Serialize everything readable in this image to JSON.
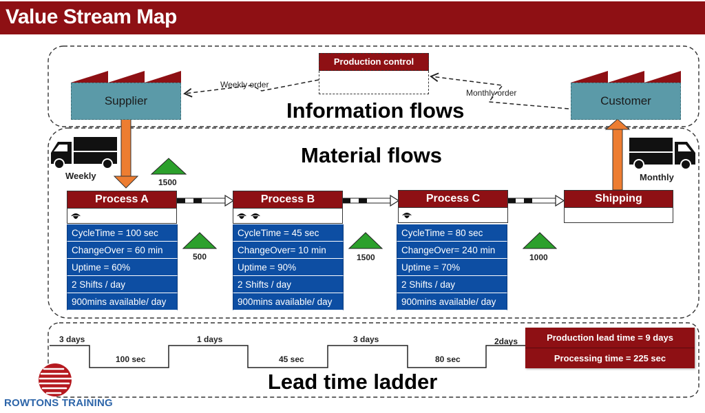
{
  "header": {
    "title": "Value Stream Map"
  },
  "sections": {
    "information": "Information flows",
    "material": "Material flows",
    "ladder": "Lead time ladder"
  },
  "supplier": {
    "label": "Supplier"
  },
  "customer": {
    "label": "Customer"
  },
  "production_control": {
    "label": "Production control"
  },
  "orders": {
    "weekly": "Weekly order",
    "monthly": "Monthly order"
  },
  "trucks": {
    "inbound": "Weekly",
    "outbound": "Monthly"
  },
  "processes": [
    {
      "name": "Process A",
      "operators": 1,
      "data": [
        "CycleTime = 100 sec",
        "ChangeOver = 60 min",
        "Uptime = 60%",
        "2 Shifts / day",
        "900mins available/ day"
      ]
    },
    {
      "name": "Process B",
      "operators": 2,
      "data": [
        "CycleTime = 45 sec",
        "ChangeOver= 10 min",
        "Uptime = 90%",
        "2 Shifts / day",
        "900mins available/ day"
      ]
    },
    {
      "name": "Process C",
      "operators": 1,
      "data": [
        "CycleTime = 80 sec",
        "ChangeOver= 240 min",
        "Uptime = 70%",
        "2 Shifts / day",
        "900mins available/ day"
      ]
    },
    {
      "name": "Shipping",
      "operators": 0,
      "data": []
    }
  ],
  "inventory": [
    "1500",
    "500",
    "1500",
    "1000"
  ],
  "ladder": {
    "wait": [
      "3 days",
      "1 days",
      "3 days",
      "2days"
    ],
    "process": [
      "100 sec",
      "45 sec",
      "80 sec"
    ]
  },
  "summary": {
    "lead_time": "Production lead time = 9 days",
    "processing_time": "Processing time = 225 sec"
  },
  "brand": {
    "name": "ROWTONS TRAINING"
  },
  "colors": {
    "brand_red": "#8e1014",
    "process_blue": "#0d4ea3",
    "factory_teal": "#5b9aa8",
    "push_orange": "#ed7d31",
    "inventory_green": "#2ca02c"
  }
}
